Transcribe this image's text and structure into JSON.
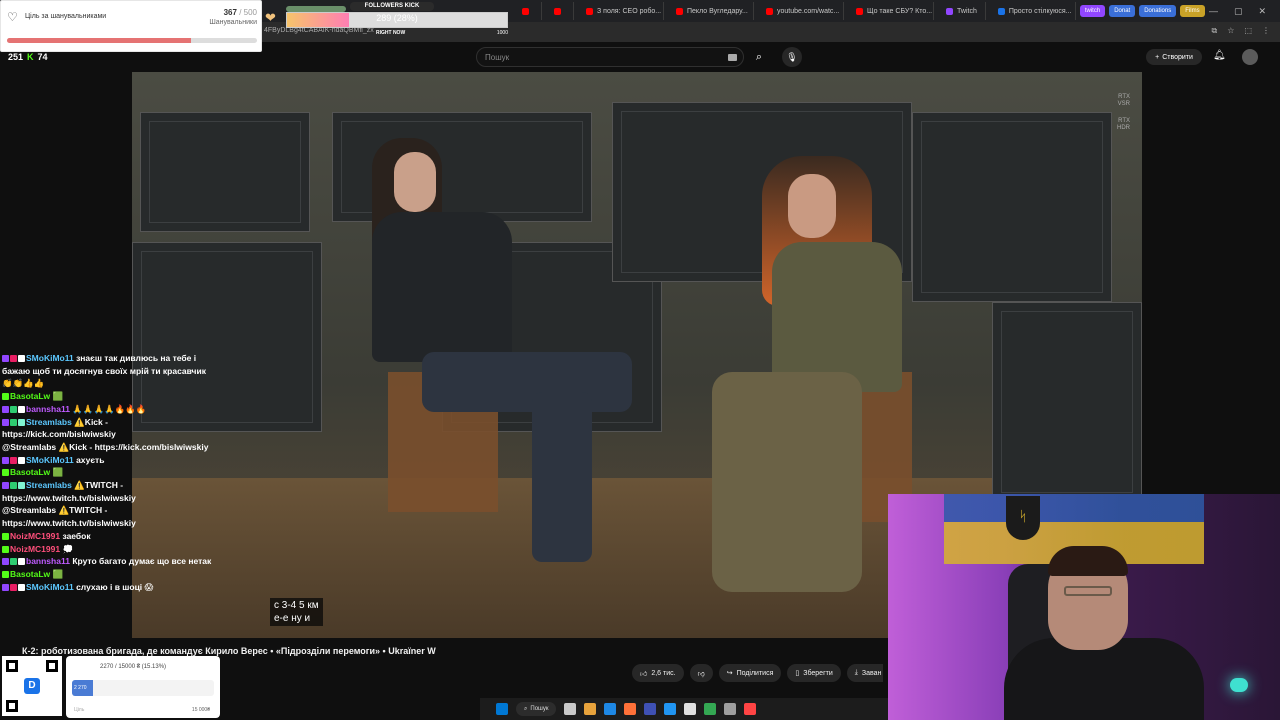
{
  "browser": {
    "tabs": [
      {
        "label": "",
        "type": "youtube"
      },
      {
        "label": "",
        "type": "youtube"
      },
      {
        "label": "З поля: CEO робо...",
        "type": "youtube"
      },
      {
        "label": "Пекло Вугледару...",
        "type": "youtube"
      },
      {
        "label": "youtube.com/watc...",
        "type": "youtube"
      },
      {
        "label": "Що таке СБУ? Кто...",
        "type": "youtube"
      },
      {
        "label": "Twitch",
        "type": "twitch"
      },
      {
        "label": "Просто стілкуюся...",
        "type": "blue"
      }
    ],
    "pills": [
      {
        "label": "twitch",
        "color": "#9146ff"
      },
      {
        "label": "Donat",
        "color": "#3a6fd8"
      },
      {
        "label": "Donations",
        "color": "#3a6fd8"
      },
      {
        "label": "Films",
        "color": "#c9a227"
      }
    ],
    "url_fragment": "4FByDLBg4tCABAIK-ndaQBMfl_zx",
    "window_controls": [
      "—",
      "▢",
      "✕"
    ]
  },
  "youtube": {
    "search_placeholder": "Пошук",
    "create_label": "Створити",
    "video_title": "К-2: роботизована бригада, де командує Кирило Верес • «Підрозділи перемоги» • Ukraïner W",
    "subtitle_line1": "с 3-4 5 км",
    "subtitle_line2": "е-е ну и",
    "rtx1a": "RTX",
    "rtx1b": "VSR",
    "rtx2a": "RTX",
    "rtx2b": "HDR",
    "like_count": "2,6 тис.",
    "share_label": "Поділитися",
    "save_label": "Зберегти",
    "download_label": "Заван"
  },
  "overlay": {
    "viewer_count": "251",
    "kick_count": "74",
    "goal": {
      "title": "Ціль за шанувальниками",
      "current": "367",
      "target": "/ 500",
      "unit": "Шанувальники",
      "progress": 0.734
    },
    "kick_followers": {
      "title": "FOLLOWERS KICK",
      "value": "289 (28%)",
      "progress": 0.28,
      "right_now": "RIGHT NOW",
      "max": "1000"
    },
    "donation": {
      "header": "2270 / 15000 ₴ (15.13%)",
      "fill_label": "2 270",
      "left_label": "Ціль",
      "right_label": "15 000₴",
      "progress": 0.1513
    }
  },
  "chat": [
    {
      "user": "SMoKiMo11",
      "color": "#5cc8ff",
      "text": "знаєш так дивлюсь на тебе і бажаю щоб ти досягнув своїх мрій ти красавчик 👏👏👍👍",
      "badges": [
        "#9146ff",
        "#e91e63",
        "#ffffff"
      ]
    },
    {
      "user": "BasotaLw",
      "color": "#53fc18",
      "text": "🟩",
      "badges": [
        "#53fc18"
      ]
    },
    {
      "user": "bannsha11",
      "color": "#bf5bff",
      "text": "🙏🙏🙏🙏🔥🔥🔥",
      "badges": [
        "#9146ff",
        "#2ecc71",
        "#ffffff"
      ]
    },
    {
      "user": "Streamlabs",
      "color": "#5cc8ff",
      "text": "⚠️Kick - https://kick.com/bislwiwskiy",
      "badges": [
        "#9146ff",
        "#2ecc71",
        "#80f5d2"
      ]
    },
    {
      "user": "@Streamlabs",
      "color": "#ffffff",
      "text": "⚠️Kick - https://kick.com/bislwiwskiy",
      "badges": []
    },
    {
      "user": "SMoKiMo11",
      "color": "#5cc8ff",
      "text": "ахуєть",
      "badges": [
        "#9146ff",
        "#e91e63",
        "#ffffff"
      ]
    },
    {
      "user": "BasotaLw",
      "color": "#53fc18",
      "text": "🟩",
      "badges": [
        "#53fc18"
      ]
    },
    {
      "user": "Streamlabs",
      "color": "#5cc8ff",
      "text": "⚠️TWITCH - https://www.twitch.tv/bislwiwskiy",
      "badges": [
        "#9146ff",
        "#2ecc71",
        "#80f5d2"
      ]
    },
    {
      "user": "@Streamlabs",
      "color": "#ffffff",
      "text": "⚠️TWITCH - https://www.twitch.tv/bislwiwskiy",
      "badges": []
    },
    {
      "user": "NoizMC1991",
      "color": "#ff4f7b",
      "text": "заебок",
      "badges": [
        "#53fc18"
      ]
    },
    {
      "user": "NoizMC1991",
      "color": "#ff4f7b",
      "text": "💭",
      "badges": [
        "#53fc18"
      ]
    },
    {
      "user": "bannsha11",
      "color": "#bf5bff",
      "text": "Круто багато думає що все нетак",
      "badges": [
        "#9146ff",
        "#2ecc71",
        "#ffffff"
      ]
    },
    {
      "user": "BasotaLw",
      "color": "#53fc18",
      "text": "🟩",
      "badges": [
        "#53fc18"
      ]
    },
    {
      "user": "SMoKiMo11",
      "color": "#5cc8ff",
      "text": "слухаю і в шоці 😱",
      "badges": [
        "#9146ff",
        "#e91e63",
        "#ffffff"
      ]
    }
  ],
  "taskbar": {
    "search_label": "Пошук",
    "icon_colors": [
      "#0078d4",
      "#c9c9c9",
      "#e8a33c",
      "#1e88e5",
      "#ff7139",
      "#3f51b5",
      "#2196f3",
      "#e0e0e0",
      "#34a853",
      "#9e9e9e",
      "#ff4444"
    ]
  },
  "icons": {
    "search": "search-icon",
    "mic": "mic-icon",
    "bell": "bell-icon",
    "like": "thumb-up-icon",
    "dislike": "thumb-down-icon",
    "share": "share-icon",
    "save": "bookmark-icon",
    "download": "download-icon"
  }
}
